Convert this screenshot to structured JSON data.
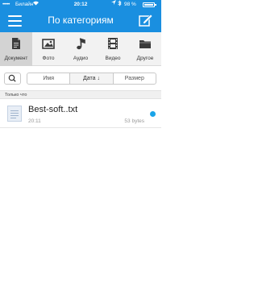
{
  "status_bar": {
    "signal": "•••••",
    "carrier": "Билайн",
    "time": "20:12",
    "battery": "98 %",
    "battery_level": 0.98
  },
  "header": {
    "title": "По категориям",
    "menu_icon": "hamburger-icon",
    "edit_icon": "compose-icon",
    "color": "#1a8fe0"
  },
  "categories": [
    {
      "label": "Документ",
      "icon": "document-icon",
      "active": true
    },
    {
      "label": "Фото",
      "icon": "photo-icon",
      "active": false
    },
    {
      "label": "Аудио",
      "icon": "music-note-icon",
      "active": false
    },
    {
      "label": "Видео",
      "icon": "film-icon",
      "active": false
    },
    {
      "label": "Другое",
      "icon": "folder-icon",
      "active": false
    }
  ],
  "sort": {
    "search_icon": "search-icon",
    "options": [
      "Имя",
      "Дата ↓",
      "Размер"
    ],
    "active_index": 1
  },
  "section_title": "Только что",
  "files": [
    {
      "name": "Best-soft..txt",
      "time": "20:11",
      "size": "53 bytes",
      "icon": "text-file-icon",
      "unread_dot_color": "#1aa4e8"
    }
  ]
}
